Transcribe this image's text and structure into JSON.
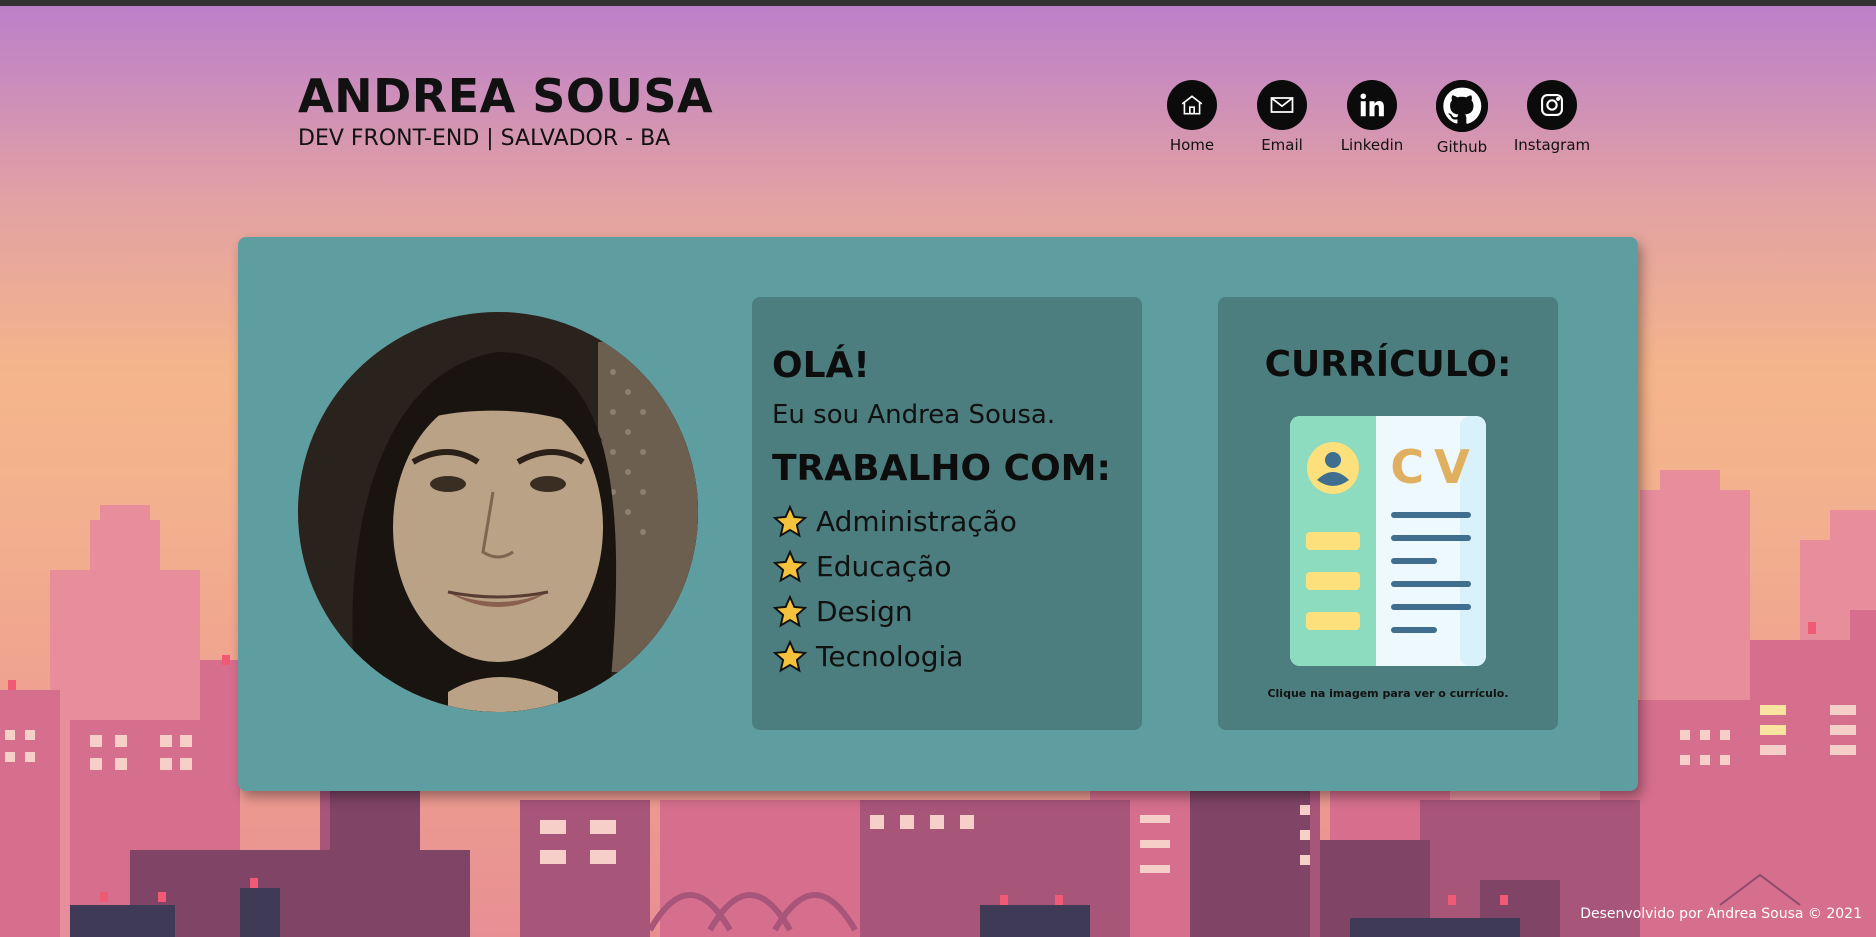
{
  "header": {
    "name": "ANDREA SOUSA",
    "subtitle": "DEV FRONT-END | SALVADOR - BA"
  },
  "nav": [
    {
      "label": "Home",
      "icon": "home-icon"
    },
    {
      "label": "Email",
      "icon": "email-icon"
    },
    {
      "label": "Linkedin",
      "icon": "linkedin-icon"
    },
    {
      "label": "Github",
      "icon": "github-icon"
    },
    {
      "label": "Instagram",
      "icon": "instagram-icon"
    }
  ],
  "about": {
    "greeting": "OLÁ!",
    "intro": "Eu sou Andrea Sousa.",
    "work_title": "TRABALHO COM:",
    "skills": [
      "Administração",
      "Educação",
      "Design",
      "Tecnologia"
    ]
  },
  "cv": {
    "title": "CURRÍCULO:",
    "image_text": "CV",
    "hint": "Clique na imagem para ver o currículo."
  },
  "footer": {
    "text": "Desenvolvido por Andrea Sousa © 2021"
  },
  "colors": {
    "panel": "#5f9ea0",
    "card": "#4c7e7f",
    "star": "#f5c33b",
    "cv_green": "#8edcc0",
    "cv_gold": "#e0b060"
  }
}
